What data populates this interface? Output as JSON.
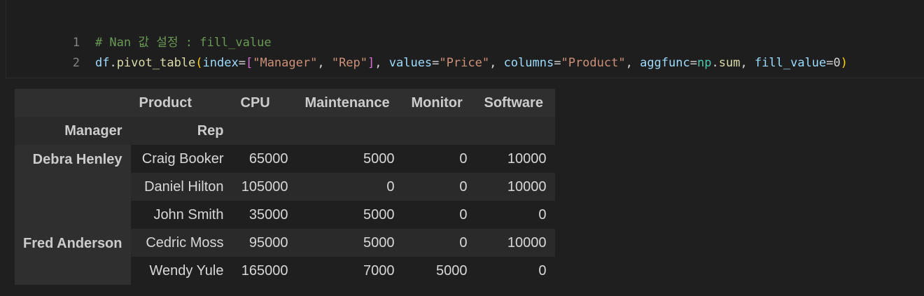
{
  "code": {
    "line1_no": "1",
    "line2_no": "2",
    "comment": "# Nan 값 설정 : fill_value",
    "tokens": {
      "df": "df",
      "dot1": ".",
      "fn": "pivot_table",
      "open": "(",
      "index": "index",
      "eq1": "=",
      "lbr": "[",
      "s1": "\"Manager\"",
      "comma1": ", ",
      "s2": "\"Rep\"",
      "rbr": "]",
      "comma2": ", ",
      "values": "values",
      "eq2": "=",
      "s3": "\"Price\"",
      "comma3": ", ",
      "columns": "columns",
      "eq3": "=",
      "s4": "\"Product\"",
      "comma4": ", ",
      "aggfunc": "aggfunc",
      "eq4": "=",
      "np": "np",
      "dot2": ".",
      "sum": "sum",
      "comma5": ", ",
      "fill": "fill_value",
      "eq5": "=",
      "zero": "0",
      "close": ")"
    }
  },
  "table": {
    "header_row1": {
      "label": "Product",
      "columns": [
        "CPU",
        "Maintenance",
        "Monitor",
        "Software"
      ]
    },
    "header_row2": {
      "index1": "Manager",
      "index2": "Rep"
    },
    "groups": [
      {
        "manager": "Debra Henley",
        "rows": [
          {
            "rep": "Craig Booker",
            "values": [
              "65000",
              "5000",
              "0",
              "10000"
            ]
          },
          {
            "rep": "Daniel Hilton",
            "values": [
              "105000",
              "0",
              "0",
              "10000"
            ]
          },
          {
            "rep": "John Smith",
            "values": [
              "35000",
              "5000",
              "0",
              "0"
            ]
          }
        ]
      },
      {
        "manager": "Fred Anderson",
        "rows": [
          {
            "rep": "Cedric Moss",
            "values": [
              "95000",
              "5000",
              "0",
              "10000"
            ]
          },
          {
            "rep": "Wendy Yule",
            "values": [
              "165000",
              "7000",
              "5000",
              "0"
            ]
          }
        ]
      }
    ]
  }
}
